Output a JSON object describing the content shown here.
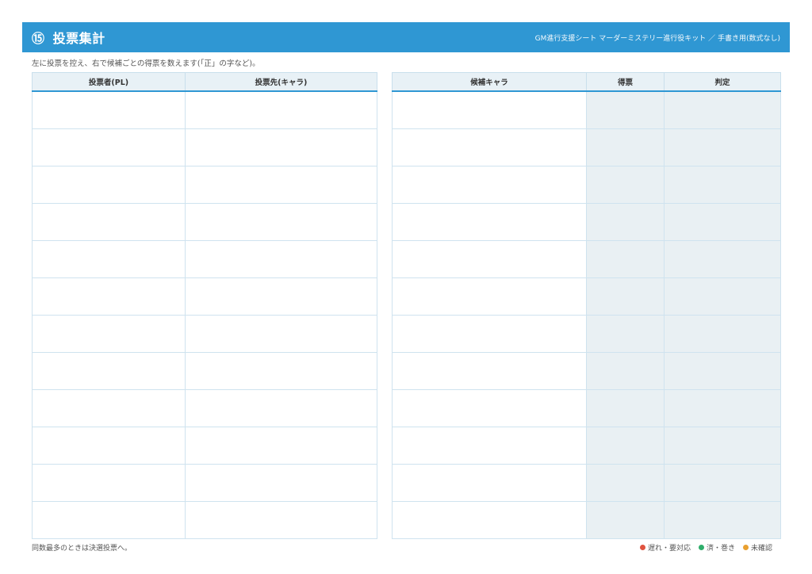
{
  "header": {
    "number": "⑮",
    "title": "投票集計",
    "subtitle": "GM進行支援シート マーダーミステリー進行役キット ／ 手書き用(数式なし)"
  },
  "instruction": "左に投票を控え、右で候補ごとの得票を数えます(「正」の字など)。",
  "left_table": {
    "columns": [
      "投票者(PL)",
      "投票先(キャラ)"
    ],
    "row_count": 12
  },
  "right_table": {
    "columns": [
      "候補キャラ",
      "得票",
      "判定"
    ],
    "row_count": 12
  },
  "footer_note": "同数最多のときは決選投票へ。",
  "legend": [
    {
      "label": "遅れ・要対応",
      "color": "#e0533f"
    },
    {
      "label": "済・巻き",
      "color": "#2fae6b"
    },
    {
      "label": "未確認",
      "color": "#e9a030"
    }
  ],
  "colors": {
    "accent": "#2f97d3",
    "shade": "#e9f0f3"
  }
}
